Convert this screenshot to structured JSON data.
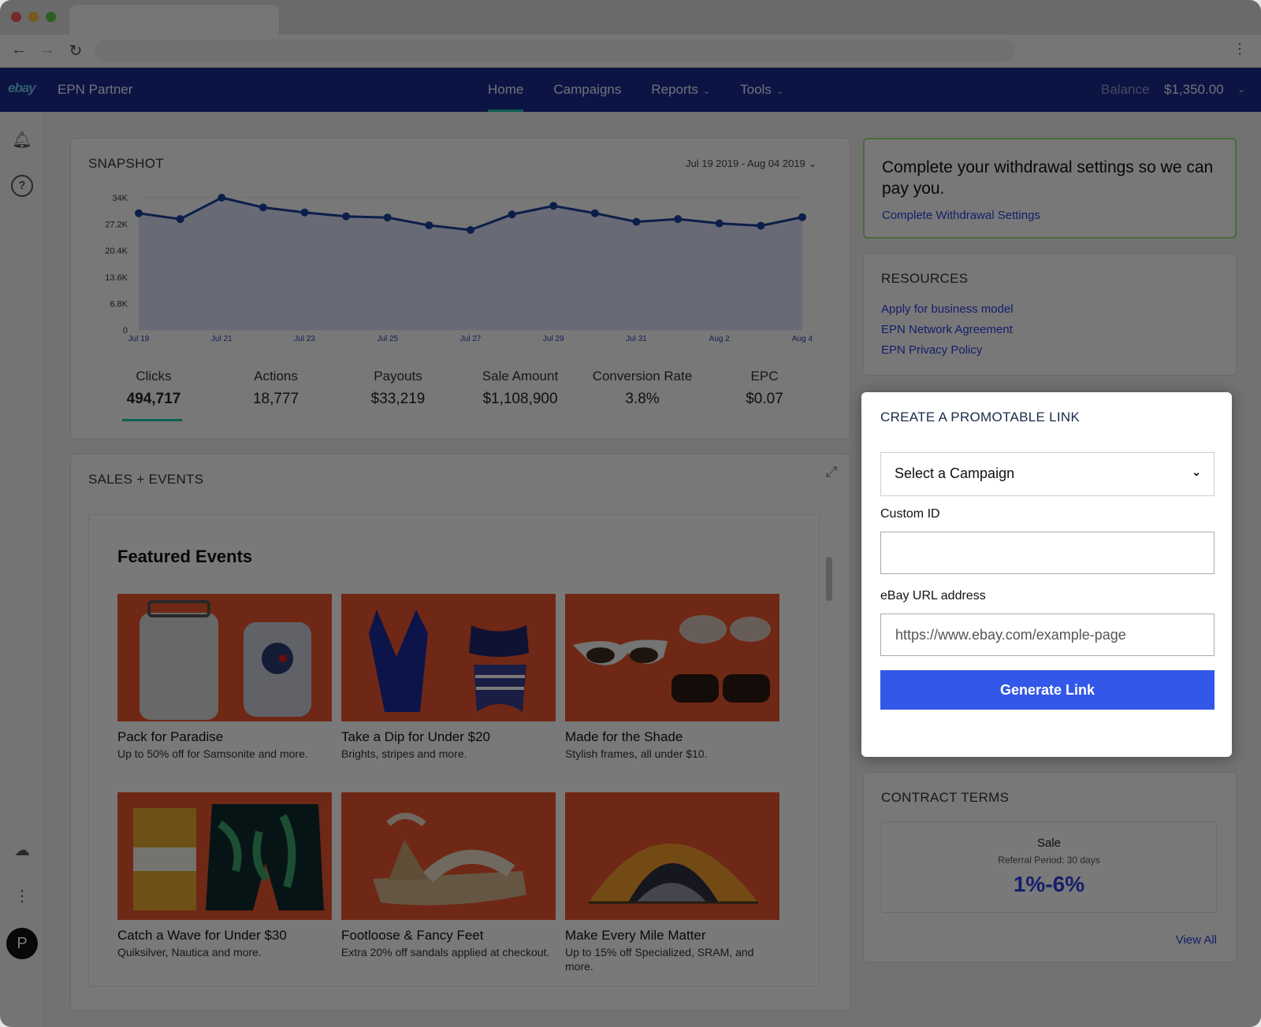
{
  "nav": {
    "logo": "ebay",
    "brand": "EPN Partner",
    "links": [
      {
        "label": "Home"
      },
      {
        "label": "Campaigns"
      },
      {
        "label": "Reports"
      },
      {
        "label": "Tools"
      }
    ],
    "balance_label": "Balance",
    "balance_value": "$1,350.00"
  },
  "snapshot": {
    "title": "SNAPSHOT",
    "date_range": "Jul 19 2019 - Aug 04 2019",
    "metrics": [
      {
        "label": "Clicks",
        "value": "494,717"
      },
      {
        "label": "Actions",
        "value": "18,777"
      },
      {
        "label": "Payouts",
        "value": "$33,219"
      },
      {
        "label": "Sale Amount",
        "value": "$1,108,900"
      },
      {
        "label": "Conversion Rate",
        "value": "3.8%"
      },
      {
        "label": "EPC",
        "value": "$0.07"
      }
    ]
  },
  "chart_data": {
    "type": "area",
    "title": "",
    "xlabel": "",
    "ylabel": "",
    "ylim": [
      0,
      34000
    ],
    "yticks": [
      "0",
      "6.8K",
      "13.6K",
      "20.4K",
      "27.2K",
      "34K"
    ],
    "xticks": [
      "Jul 19",
      "Jul 21",
      "Jul 23",
      "Jul 25",
      "Jul 27",
      "Jul 29",
      "Jul 31",
      "Aug 2",
      "Aug 4"
    ],
    "x": [
      "Jul 19",
      "Jul 20",
      "Jul 21",
      "Jul 22",
      "Jul 23",
      "Jul 24",
      "Jul 25",
      "Jul 26",
      "Jul 27",
      "Jul 28",
      "Jul 29",
      "Jul 30",
      "Jul 31",
      "Aug 1",
      "Aug 2",
      "Aug 3",
      "Aug 4"
    ],
    "values": [
      30000,
      28500,
      34000,
      31500,
      30200,
      29200,
      28900,
      26900,
      25700,
      29700,
      31900,
      30000,
      27800,
      28500,
      27400,
      26800,
      29000
    ],
    "grid": true
  },
  "sales": {
    "title": "SALES + EVENTS",
    "featured_title": "Featured Events",
    "events": [
      {
        "title": "Pack for Paradise",
        "desc": "Up to 50% off for Samsonite and more."
      },
      {
        "title": "Take a Dip for Under $20",
        "desc": "Brights, stripes and more."
      },
      {
        "title": "Made for the Shade",
        "desc": "Stylish frames, all under $10."
      },
      {
        "title": "Catch a Wave for Under $30",
        "desc": "Quiksilver, Nautica and more."
      },
      {
        "title": "Footloose & Fancy Feet",
        "desc": "Extra 20% off sandals applied at checkout."
      },
      {
        "title": "Make Every Mile Matter",
        "desc": "Up to 15% off Specialized, SRAM, and more."
      }
    ]
  },
  "withdraw": {
    "text": "Complete your withdrawal settings so we can pay you.",
    "link": "Complete Withdrawal Settings"
  },
  "resources": {
    "title": "RESOURCES",
    "links": [
      "Apply for business model",
      "EPN Network Agreement",
      "EPN Privacy Policy"
    ]
  },
  "promo": {
    "title": "CREATE A PROMOTABLE LINK",
    "campaign_select": "Select a Campaign",
    "custom_id_label": "Custom ID",
    "custom_id_value": "",
    "url_label": "eBay URL address",
    "url_placeholder": "https://www.ebay.com/example-page",
    "button": "Generate Link"
  },
  "contract": {
    "title": "CONTRACT TERMS",
    "type": "Sale",
    "referral": "Referral Period: 30 days",
    "rate": "1%-6%",
    "view_all": "View All"
  },
  "colors": {
    "nav_bg": "#1b2a8f",
    "accent_teal": "#1fc7ae",
    "link_blue": "#2a3fe0",
    "button_blue": "#3357e8",
    "event_bg": "#e9542c",
    "success_border": "#9adf7f"
  },
  "icons": {
    "back": "arrow-left-icon",
    "forward": "arrow-right-icon",
    "reload": "reload-icon",
    "bell": "bell-icon",
    "help": "help-icon",
    "cloud": "cloud-icon",
    "more": "more-vertical-icon",
    "expand": "expand-icon"
  }
}
